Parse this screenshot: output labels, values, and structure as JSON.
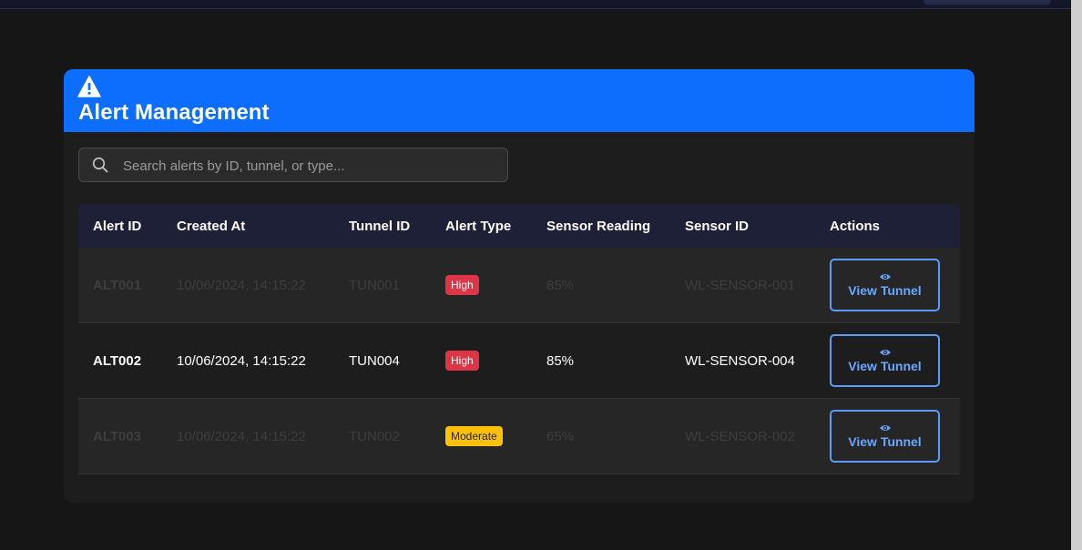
{
  "header": {
    "title": "Alert Management",
    "icon": "warning-triangle-icon"
  },
  "search": {
    "placeholder": "Search alerts by ID, tunnel, or type...",
    "value": "",
    "icon": "search-icon"
  },
  "table": {
    "columns": [
      "Alert ID",
      "Created At",
      "Tunnel ID",
      "Alert Type",
      "Sensor Reading",
      "Sensor ID",
      "Actions"
    ],
    "rows": [
      {
        "alert_id": "ALT001",
        "created_at": "10/06/2024, 14:15:22",
        "tunnel_id": "TUN001",
        "alert_type": "High",
        "sensor_reading": "85%",
        "sensor_id": "WL-SENSOR-001",
        "action": "View Tunnel"
      },
      {
        "alert_id": "ALT002",
        "created_at": "10/06/2024, 14:15:22",
        "tunnel_id": "TUN004",
        "alert_type": "High",
        "sensor_reading": "85%",
        "sensor_id": "WL-SENSOR-004",
        "action": "View Tunnel"
      },
      {
        "alert_id": "ALT003",
        "created_at": "10/06/2024, 14:15:22",
        "tunnel_id": "TUN002",
        "alert_type": "Moderate",
        "sensor_reading": "65%",
        "sensor_id": "WL-SENSOR-002",
        "action": "View Tunnel"
      }
    ]
  },
  "colors": {
    "header_bg": "#0d6efd",
    "high_badge": "#dc3545",
    "moderate_badge": "#ffc107",
    "action_border": "#5a9cf8"
  }
}
